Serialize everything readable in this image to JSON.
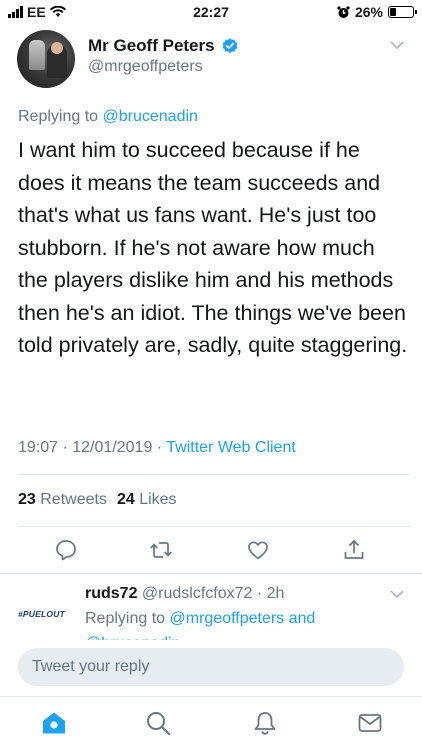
{
  "status": {
    "carrier": "EE",
    "time": "22:27",
    "battery": "26%",
    "battery_level": 0.26
  },
  "tweet": {
    "display_name": "Mr Geoff Peters",
    "handle": "@mrgeoffpeters",
    "replying_prefix": "Replying to",
    "replying_to": "@brucenadin",
    "text": "I want him to succeed because if he does it means the team succeeds and that's what us fans want. He's just too stubborn. If he's not aware how much the players dislike him and his methods then he's an idiot. The things we've been told privately are, sadly, quite staggering.",
    "datetime": "19:07 · 12/01/2019 ·",
    "client": "Twitter Web Client",
    "retweets_count": "23",
    "retweets_label": "Retweets",
    "likes_count": "24",
    "likes_label": "Likes"
  },
  "reply": {
    "avatar_text": "#PUELOUT",
    "name": "ruds72",
    "handle_time": "@rudslcfcfox72 · 2h",
    "replying_prefix": "Replying to",
    "replying_to": "@mrgeoffpeters and",
    "cut_text": "@brucenadin"
  },
  "compose": {
    "placeholder": "Tweet your reply"
  },
  "colors": {
    "accent": "#1da1f2",
    "secondary_text": "#657786",
    "divider": "#e1e8ed"
  },
  "icons": [
    "verified-icon",
    "chevron-down-icon",
    "reply-icon",
    "retweet-icon",
    "like-icon",
    "share-icon",
    "home-icon",
    "search-icon",
    "notifications-icon",
    "messages-icon"
  ]
}
